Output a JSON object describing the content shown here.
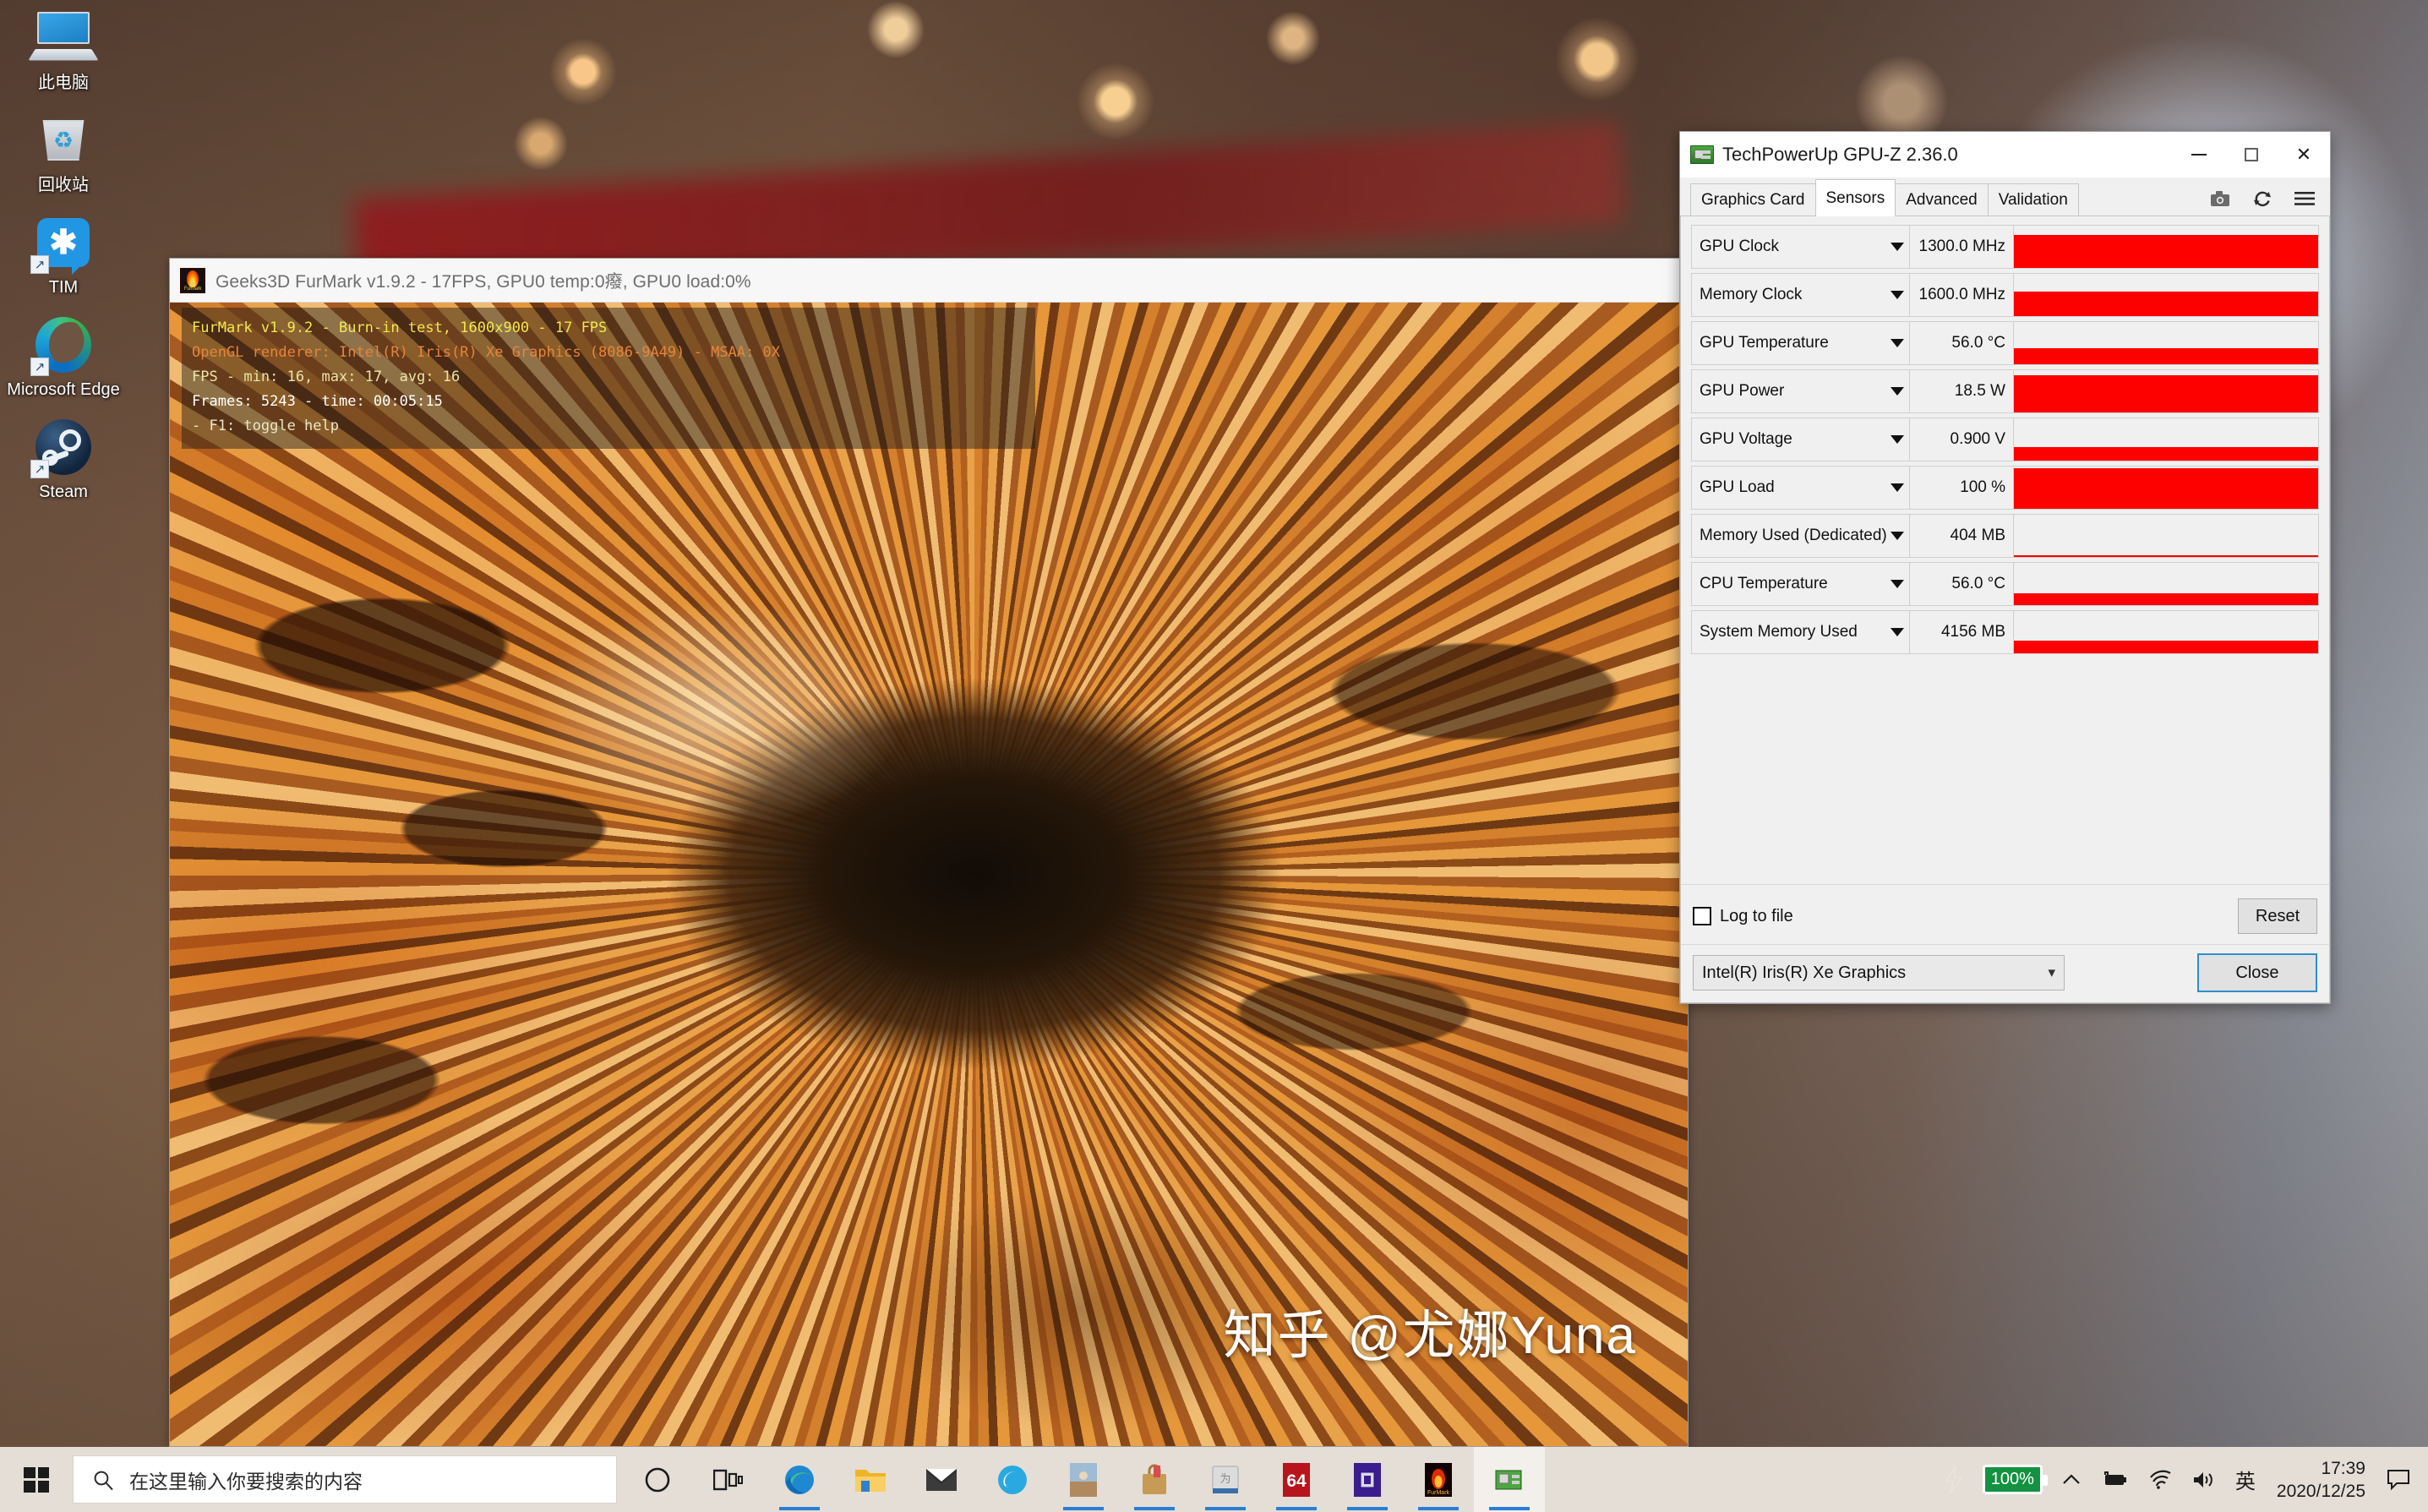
{
  "desktop": {
    "icons": [
      {
        "name": "this-pc",
        "label": "此电脑",
        "shortcut": false
      },
      {
        "name": "recycle-bin",
        "label": "回收站",
        "shortcut": false
      },
      {
        "name": "tim",
        "label": "TIM",
        "shortcut": true
      },
      {
        "name": "microsoft-edge",
        "label": "Microsoft Edge",
        "shortcut": true
      },
      {
        "name": "steam",
        "label": "Steam",
        "shortcut": true
      }
    ]
  },
  "furmark": {
    "title": "Geeks3D FurMark v1.9.2 - 17FPS, GPU0 temp:0癈, GPU0 load:0%",
    "overlay": {
      "line1": "FurMark v1.9.2 - Burn-in test, 1600x900 - 17 FPS",
      "line2": "OpenGL renderer: Intel(R) Iris(R) Xe Graphics (8086-9A49) - MSAA: 0X",
      "line3": "FPS - min: 16, max: 17, avg: 16",
      "line4": "Frames: 5243 - time: 00:05:15",
      "line5": "- F1: toggle help"
    },
    "watermark": "知乎 @尤娜Yuna"
  },
  "gpuz": {
    "title": "TechPowerUp GPU-Z 2.36.0",
    "window_controls": {
      "minimize": "—",
      "maximize": "□",
      "close": "✕"
    },
    "tabs": [
      {
        "label": "Graphics Card",
        "active": false
      },
      {
        "label": "Sensors",
        "active": true
      },
      {
        "label": "Advanced",
        "active": false
      },
      {
        "label": "Validation",
        "active": false
      }
    ],
    "toolbar": [
      {
        "name": "camera-icon",
        "title": "Screenshot"
      },
      {
        "name": "refresh-icon",
        "title": "Refresh"
      },
      {
        "name": "hamburger-menu-icon",
        "title": "Menu"
      }
    ],
    "sensors": [
      {
        "name": "GPU Clock",
        "value": "1300.0 MHz",
        "fill": 78
      },
      {
        "name": "Memory Clock",
        "value": "1600.0 MHz",
        "fill": 58
      },
      {
        "name": "GPU Temperature",
        "value": "56.0 °C",
        "fill": 38
      },
      {
        "name": "GPU Power",
        "value": "18.5 W",
        "fill": 88
      },
      {
        "name": "GPU Voltage",
        "value": "0.900 V",
        "fill": 32
      },
      {
        "name": "GPU Load",
        "value": "100 %",
        "fill": 97
      },
      {
        "name": "Memory Used (Dedicated)",
        "value": "404 MB",
        "fill": 5
      },
      {
        "name": "CPU Temperature",
        "value": "56.0 °C",
        "fill": 28
      },
      {
        "name": "System Memory Used",
        "value": "4156 MB",
        "fill": 30
      }
    ],
    "log_to_file_label": "Log to file",
    "reset_label": "Reset",
    "gpu_select_value": "Intel(R) Iris(R) Xe Graphics",
    "close_label": "Close",
    "graph_color": "#fd0000"
  },
  "taskbar": {
    "start_name": "start-button",
    "search_placeholder": "在这里输入你要搜索的内容",
    "apps": [
      {
        "name": "cortana",
        "running": false,
        "active": false
      },
      {
        "name": "task-view",
        "running": false,
        "active": false
      },
      {
        "name": "microsoft-edge",
        "running": true,
        "active": false
      },
      {
        "name": "file-explorer",
        "running": false,
        "active": false
      },
      {
        "name": "mail",
        "running": false,
        "active": false
      },
      {
        "name": "edge-legacy",
        "running": false,
        "active": false
      },
      {
        "name": "photos",
        "running": true,
        "active": false
      },
      {
        "name": "store-bag",
        "running": true,
        "active": false
      },
      {
        "name": "disk-tool",
        "running": true,
        "active": false
      },
      {
        "name": "cpu-z",
        "running": true,
        "active": false,
        "badge": "64"
      },
      {
        "name": "chip-tool",
        "running": true,
        "active": false
      },
      {
        "name": "furmark",
        "running": true,
        "active": false
      },
      {
        "name": "gpu-z",
        "running": true,
        "active": true
      }
    ],
    "tray": {
      "battery_percent": "100%",
      "ime": "英",
      "time": "17:39",
      "date": "2020/12/25",
      "battery_color": "#149241"
    }
  }
}
